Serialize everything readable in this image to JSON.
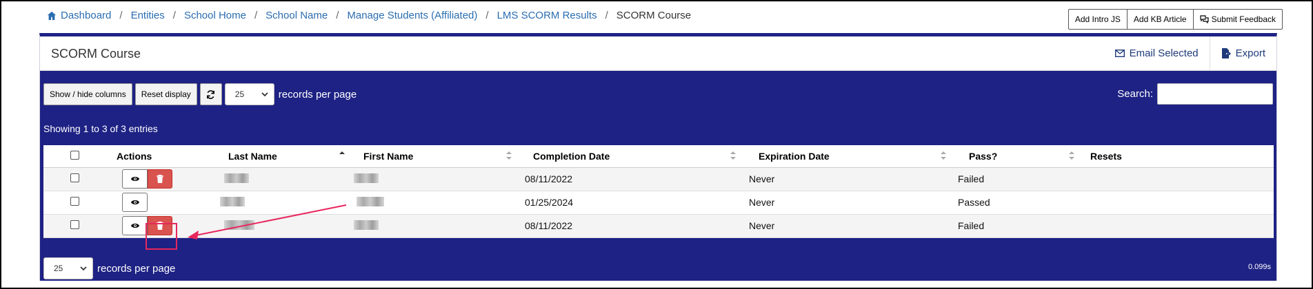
{
  "breadcrumb": {
    "items": [
      "Dashboard",
      "Entities",
      "School Home",
      "School Name",
      "Manage Students (Affiliated)",
      "LMS SCORM Results"
    ],
    "current": "SCORM Course",
    "separator": "/"
  },
  "top_buttons": {
    "intro_js": "Add Intro JS",
    "kb_article": "Add KB Article",
    "feedback": "Submit Feedback"
  },
  "panel": {
    "title": "SCORM Course",
    "email_selected": "Email Selected",
    "export": "Export"
  },
  "controls": {
    "show_hide": "Show / hide columns",
    "reset": "Reset display",
    "page_size": "25",
    "records_per_page": "records per page",
    "search_label": "Search:",
    "search_value": ""
  },
  "info": "Showing 1 to 3 of 3 entries",
  "table": {
    "headers": [
      "Actions",
      "Last Name",
      "First Name",
      "Completion Date",
      "Expiration Date",
      "Pass?",
      "Resets"
    ],
    "rows": [
      {
        "completion": "08/11/2022",
        "expiration": "Never",
        "pass": "Failed",
        "resets": ""
      },
      {
        "completion": "01/25/2024",
        "expiration": "Never",
        "pass": "Passed",
        "resets": ""
      },
      {
        "completion": "08/11/2022",
        "expiration": "Never",
        "pass": "Failed",
        "resets": ""
      }
    ]
  },
  "footer": {
    "page_size": "25",
    "records_per_page": "records per page",
    "timing": "0.099s"
  },
  "colors": {
    "header_blue": "#1e2284",
    "link": "#2a6db0",
    "danger": "#d9534f",
    "annotation": "#e8275c"
  }
}
